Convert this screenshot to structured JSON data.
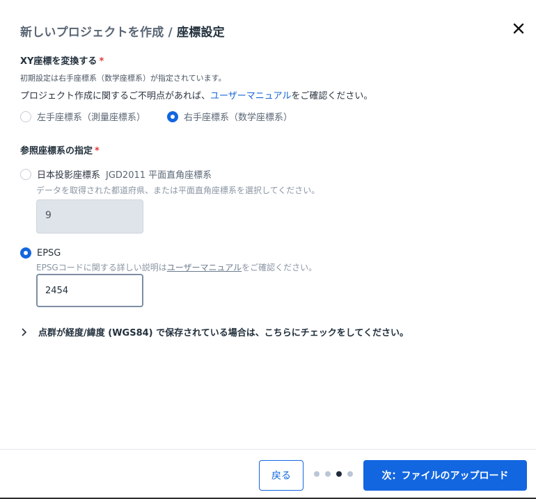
{
  "header": {
    "title_prefix": "新しいプロジェクトを作成 / ",
    "title_current": "座標設定",
    "close_icon": "close-icon"
  },
  "xy_section": {
    "label": "XY座標を変換する",
    "required_mark": "*",
    "default_note": "初期設定は右手座標系（数学座標系）が指定されています。",
    "manual_text_before": "プロジェクト作成に関するご不明点があれば、",
    "manual_link": "ユーザーマニュアル",
    "manual_text_after": "をご確認ください。",
    "options": [
      {
        "label": "左手座標系（測量座標系）",
        "selected": false
      },
      {
        "label": "右手座標系（数学座標系）",
        "selected": true
      }
    ]
  },
  "ref_section": {
    "label": "参照座標系の指定",
    "required_mark": "*",
    "japan_option": {
      "label": "日本投影座標系",
      "label_sub": "JGD2011 平面直角座標系",
      "selected": false,
      "hint": "データを取得された都道府県、または平面直角座標系を選択してください。",
      "value": "9"
    },
    "epsg_option": {
      "label": "EPSG",
      "selected": true,
      "hint_before": "EPSGコードに関する詳しい説明は",
      "hint_link": "ユーザーマニュアル",
      "hint_after": "をご確認ください。",
      "value": "2454"
    }
  },
  "expander": {
    "label": "点群が経度/緯度 (WGS84) で保存されている場合は、こちらにチェックをしてください。",
    "icon": "chevron-right-icon"
  },
  "footer": {
    "back_label": "戻る",
    "next_label": "次：ファイルのアップロード",
    "steps_total": 4,
    "current_step": 3
  },
  "colors": {
    "accent": "#1266e0",
    "required": "#e03a3a",
    "link": "#1566d6"
  }
}
